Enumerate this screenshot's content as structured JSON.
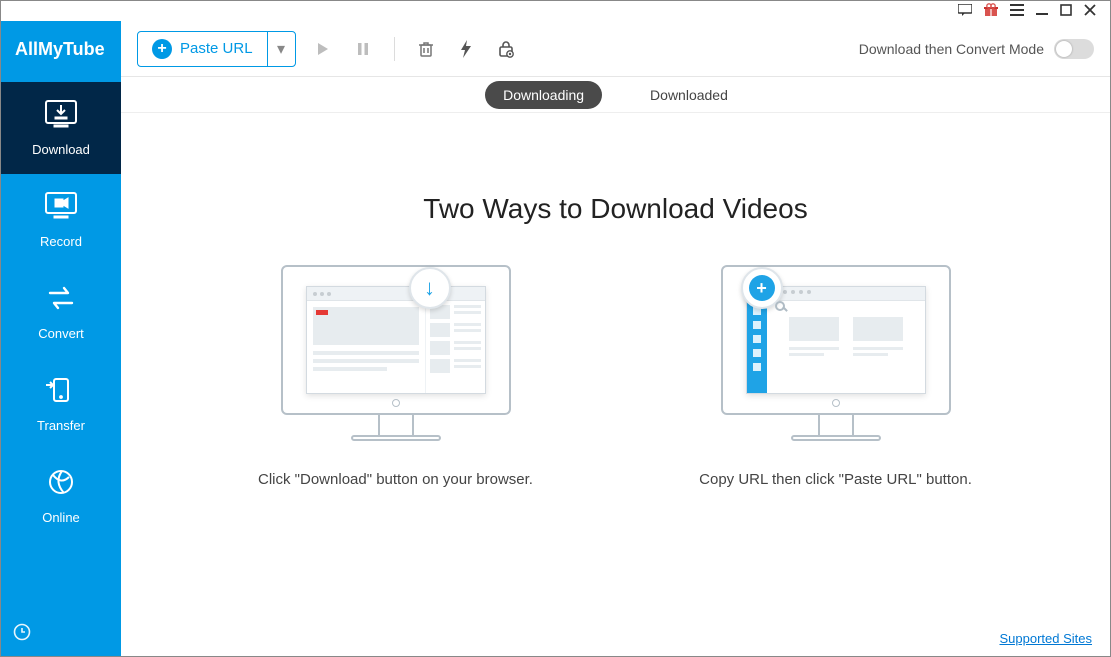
{
  "app": {
    "name": "AllMyTube"
  },
  "system_icons": {
    "feedback": "feedback",
    "gift": "gift",
    "menu": "menu",
    "minimize": "minimize",
    "maximize": "maximize",
    "close": "close"
  },
  "sidebar": {
    "items": [
      {
        "label": "Download"
      },
      {
        "label": "Record"
      },
      {
        "label": "Convert"
      },
      {
        "label": "Transfer"
      },
      {
        "label": "Online"
      }
    ]
  },
  "toolbar": {
    "paste_label": "Paste URL",
    "convert_mode_label": "Download then Convert Mode"
  },
  "tabs": {
    "downloading": "Downloading",
    "downloaded": "Downloaded"
  },
  "content": {
    "headline": "Two Ways to Download Videos",
    "way1_caption": "Click \"Download\" button on your browser.",
    "way2_caption": "Copy URL then click \"Paste URL\" button."
  },
  "footer": {
    "supported_sites": "Supported Sites"
  }
}
